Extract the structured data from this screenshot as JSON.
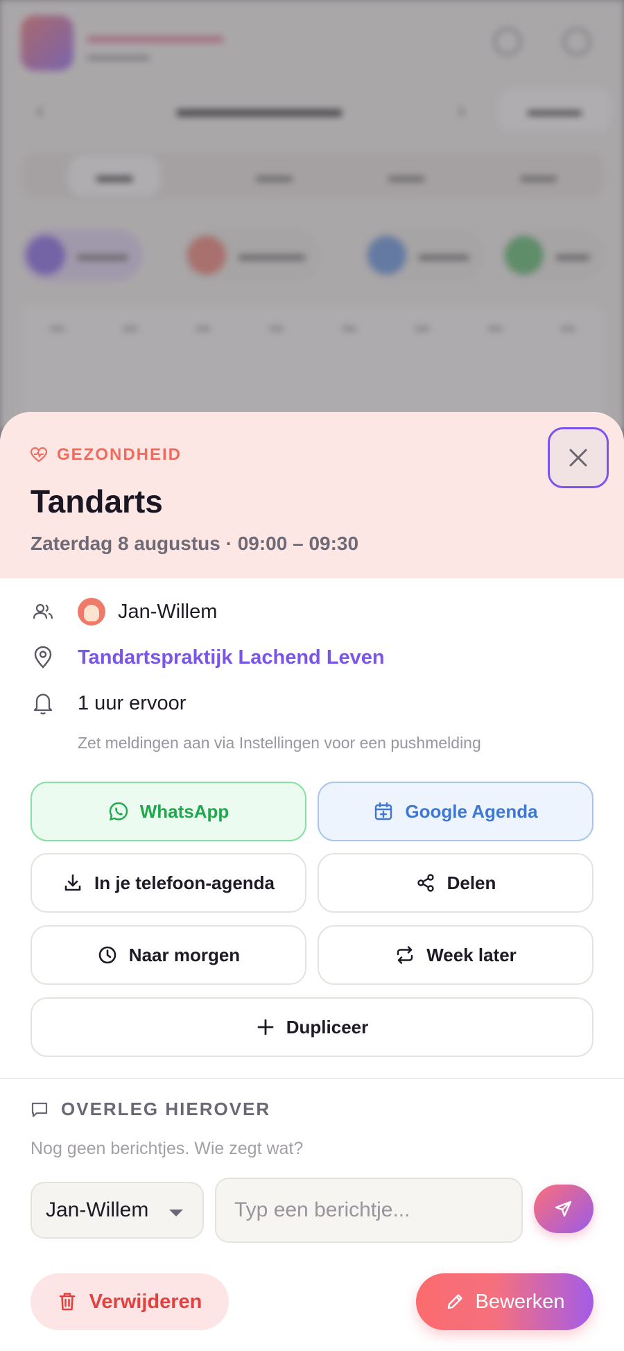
{
  "event": {
    "category": "GEZONDHEID",
    "title": "Tandarts",
    "datetime": "Zaterdag 8 augustus · 09:00 – 09:30",
    "person": "Jan-Willem",
    "location": "Tandartspraktijk Lachend Leven",
    "reminder": "1 uur ervoor",
    "reminder_hint": "Zet meldingen aan via Instellingen voor een pushmelding"
  },
  "actions": {
    "whatsapp": "WhatsApp",
    "google_calendar": "Google Agenda",
    "phone_calendar": "In je telefoon-agenda",
    "share": "Delen",
    "to_tomorrow": "Naar morgen",
    "week_later": "Week later",
    "duplicate": "Dupliceer"
  },
  "discussion": {
    "title": "OVERLEG HIEROVER",
    "empty": "Nog geen berichtjes. Wie zegt wat?",
    "sender": "Jan-Willem",
    "placeholder": "Typ een berichtje..."
  },
  "footer": {
    "delete": "Verwijderen",
    "edit": "Bewerken"
  },
  "colors": {
    "accent_purple": "#7a55e6",
    "category_red": "#ef6b5d",
    "whatsapp_green": "#1fa84d",
    "google_blue": "#3f78d4",
    "delete_red": "#e2413f"
  }
}
